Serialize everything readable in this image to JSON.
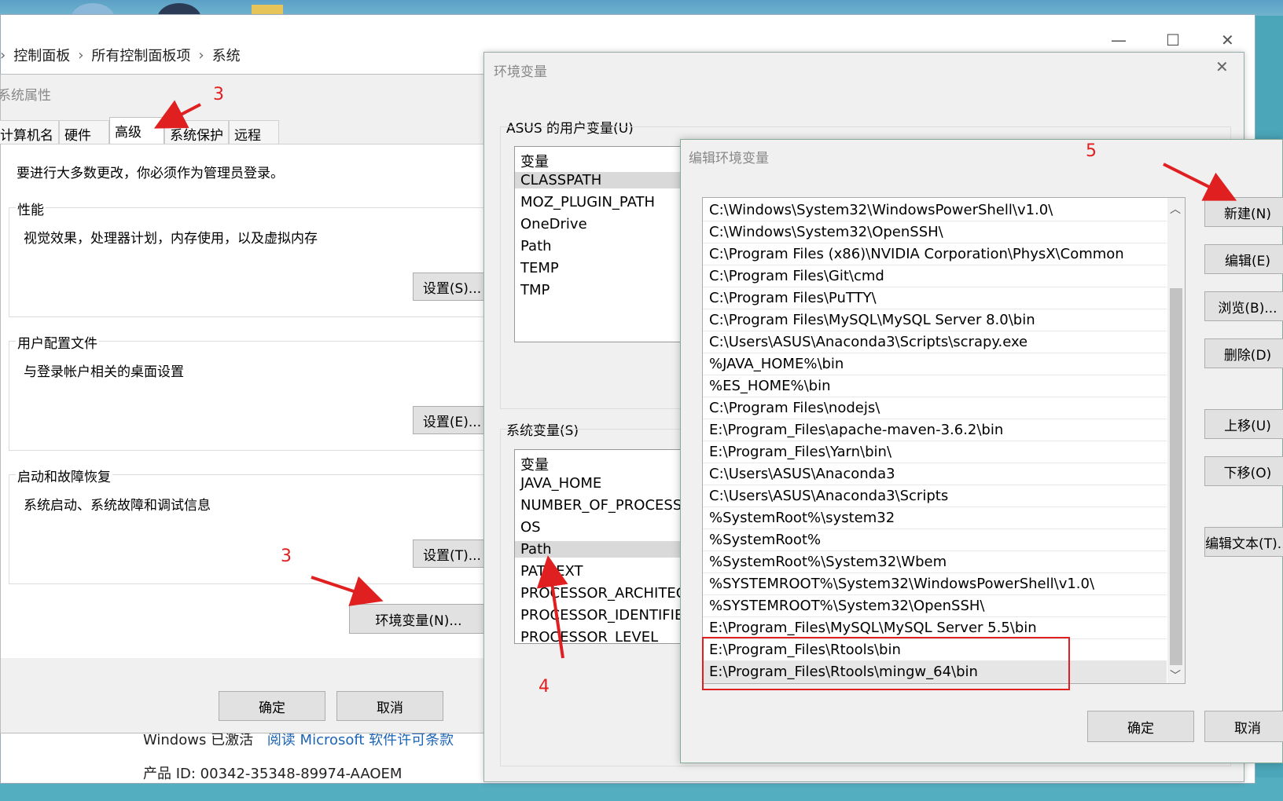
{
  "control_panel": {
    "breadcrumb": [
      "控制面板",
      "所有控制面板项",
      "系统"
    ],
    "activation_text": "Windows 已激活",
    "license_link": "阅读 Microsoft 软件许可条款",
    "product_id": "产品 ID: 00342-35348-89974-AAOEM",
    "minimize": "—",
    "maximize": "☐",
    "close": "✕"
  },
  "system_properties": {
    "title": "系统属性",
    "tabs": [
      "计算机名",
      "硬件",
      "高级",
      "系统保护",
      "远程"
    ],
    "active_tab": "高级",
    "admin_note": "要进行大多数更改，你必须作为管理员登录。",
    "performance": {
      "title": "性能",
      "desc": "视觉效果，处理器计划，内存使用，以及虚拟内存",
      "button": "设置(S)..."
    },
    "user_profiles": {
      "title": "用户配置文件",
      "desc": "与登录帐户相关的桌面设置",
      "button": "设置(E)..."
    },
    "startup": {
      "title": "启动和故障恢复",
      "desc": "系统启动、系统故障和调试信息",
      "button": "设置(T)..."
    },
    "env_button": "环境变量(N)...",
    "ok": "确定",
    "cancel": "取消"
  },
  "env_vars": {
    "title": "环境变量",
    "close": "✕",
    "user_group": "ASUS 的用户变量(U)",
    "user_header": "变量",
    "user_vars": [
      "CLASSPATH",
      "MOZ_PLUGIN_PATH",
      "OneDrive",
      "Path",
      "TEMP",
      "TMP"
    ],
    "system_group": "系统变量(S)",
    "system_header": "变量",
    "system_vars": [
      "JAVA_HOME",
      "NUMBER_OF_PROCESSORS",
      "OS",
      "Path",
      "PATHEXT",
      "PROCESSOR_ARCHITECTURE",
      "PROCESSOR_IDENTIFIER",
      "PROCESSOR_LEVEL"
    ]
  },
  "edit_env": {
    "title": "编辑环境变量",
    "paths": [
      "C:\\Windows\\System32\\WindowsPowerShell\\v1.0\\",
      "C:\\Windows\\System32\\OpenSSH\\",
      "C:\\Program Files (x86)\\NVIDIA Corporation\\PhysX\\Common",
      "C:\\Program Files\\Git\\cmd",
      "C:\\Program Files\\PuTTY\\",
      "C:\\Program Files\\MySQL\\MySQL Server 8.0\\bin",
      "C:\\Users\\ASUS\\Anaconda3\\Scripts\\scrapy.exe",
      "%JAVA_HOME%\\bin",
      "%ES_HOME%\\bin",
      "C:\\Program Files\\nodejs\\",
      "E:\\Program_Files\\apache-maven-3.6.2\\bin",
      "E:\\Program_Files\\Yarn\\bin\\",
      "C:\\Users\\ASUS\\Anaconda3",
      "C:\\Users\\ASUS\\Anaconda3\\Scripts",
      "%SystemRoot%\\system32",
      "%SystemRoot%",
      "%SystemRoot%\\System32\\Wbem",
      "%SYSTEMROOT%\\System32\\WindowsPowerShell\\v1.0\\",
      "%SYSTEMROOT%\\System32\\OpenSSH\\",
      "E:\\Program_Files\\MySQL\\MySQL Server 5.5\\bin",
      "E:\\Program_Files\\Rtools\\bin",
      "E:\\Program_Files\\Rtools\\mingw_64\\bin"
    ],
    "buttons": {
      "new": "新建(N)",
      "edit": "编辑(E)",
      "browse": "浏览(B)...",
      "delete": "删除(D)",
      "move_up": "上移(U)",
      "move_down": "下移(O)",
      "edit_text": "编辑文本(T)..."
    },
    "ok": "确定",
    "cancel": "取消"
  },
  "annotations": [
    "3",
    "3",
    "4",
    "5"
  ],
  "colors": {
    "annotation": "#e02020",
    "link": "#1c64b6"
  }
}
